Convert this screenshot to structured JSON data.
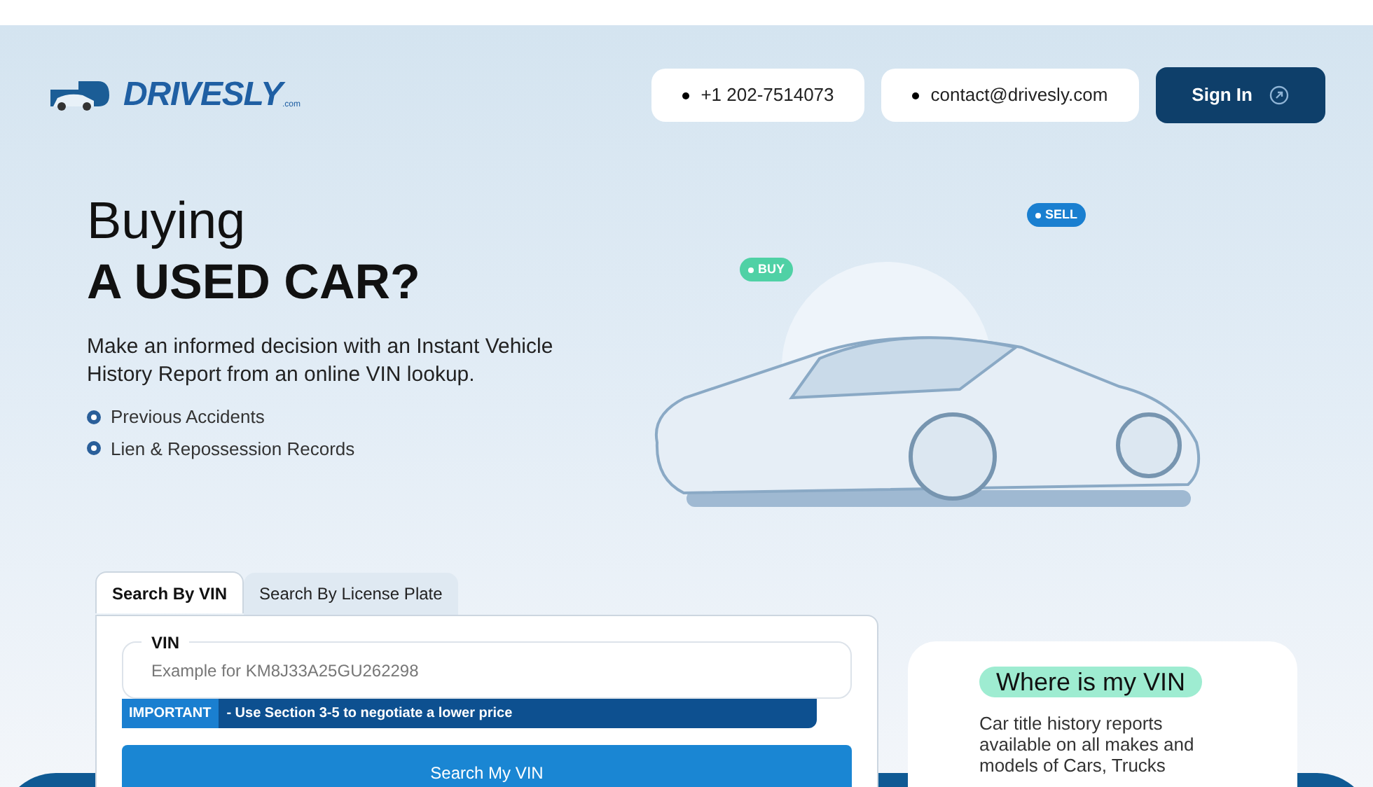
{
  "header": {
    "logo": {
      "wordmark": "DRIVESLY",
      "suffix": ".com"
    },
    "contacts": [
      {
        "text": "+1 202-7514073"
      },
      {
        "text": "contact@drivesly.com"
      }
    ],
    "sign_in": "Sign In"
  },
  "hero": {
    "title_line_1": "Buying",
    "title_line_2": "A USED CAR?",
    "description": "Make an informed decision with an Instant Vehicle History Report from an online VIN lookup.",
    "features": [
      "Previous Accidents",
      "Lien & Repossession Records"
    ],
    "badges": [
      {
        "label": "BUY",
        "color": "#4fd1a5"
      },
      {
        "label": "SELL",
        "color": "#1a7fd0"
      }
    ]
  },
  "search": {
    "tabs": [
      {
        "label": "Search By VIN",
        "selected": true
      },
      {
        "label": "Search By License Plate",
        "selected": false
      }
    ],
    "field": {
      "label": "VIN",
      "placeholder": "Example for KM8J33A25GU262298"
    },
    "notice": {
      "tag": "IMPORTANT",
      "text": "- Use Section 3-5 to negotiate a lower price"
    },
    "button": "Search My VIN"
  },
  "info_card": {
    "title": "Where is my VIN",
    "text": "Car title history reports available on all makes and models of Cars, Trucks"
  }
}
